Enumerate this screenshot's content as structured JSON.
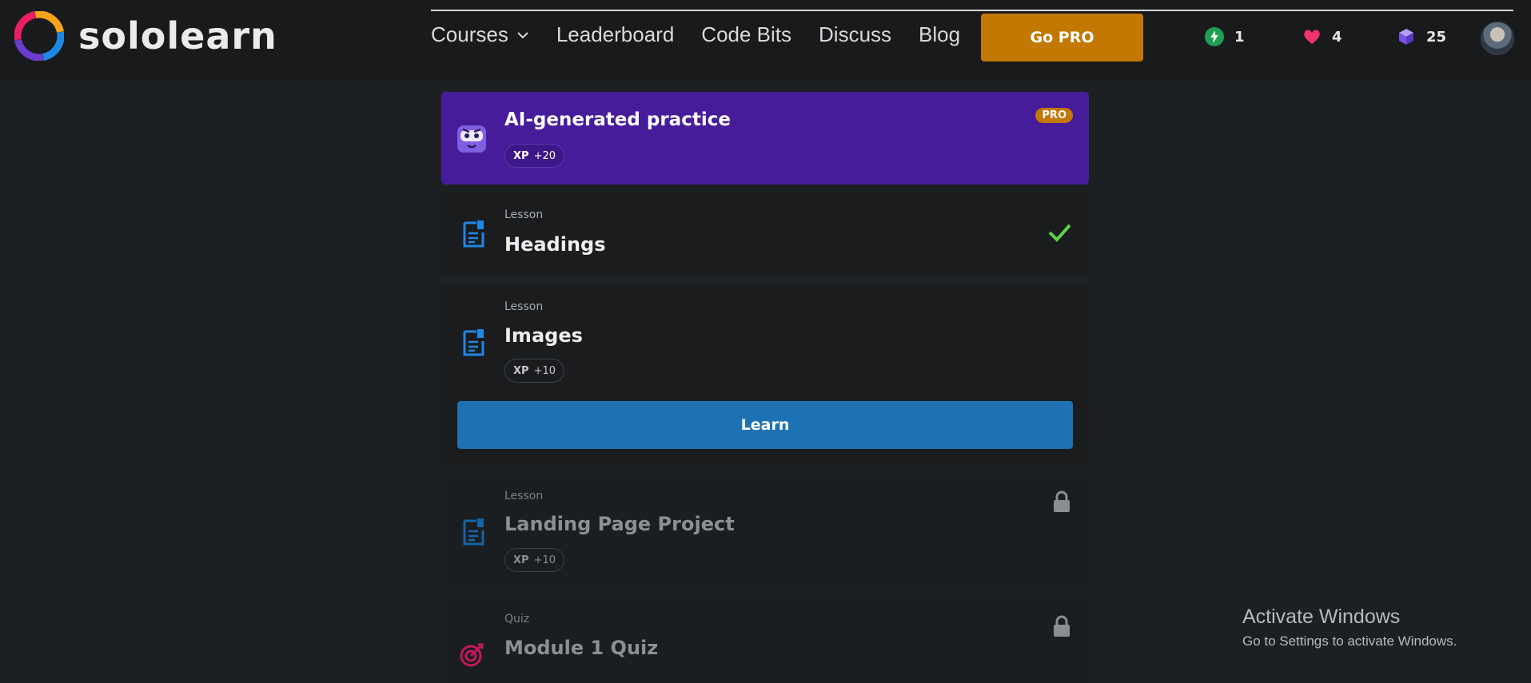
{
  "brand": {
    "name": "sololearn"
  },
  "nav": {
    "courses": "Courses",
    "leaderboard": "Leaderboard",
    "code_bits": "Code Bits",
    "discuss": "Discuss",
    "blog": "Blog",
    "go_pro": "Go PRO"
  },
  "stats": {
    "streak": "1",
    "hearts": "4",
    "gems": "25"
  },
  "ai_practice": {
    "title": "AI-generated practice",
    "badge": "PRO",
    "xp_label": "XP",
    "xp_value": "+20"
  },
  "lessons": [
    {
      "kind": "Lesson",
      "title": "Headings",
      "status": "completed"
    },
    {
      "kind": "Lesson",
      "title": "Images",
      "xp_label": "XP",
      "xp_value": "+10",
      "button": "Learn",
      "status": "current"
    },
    {
      "kind": "Lesson",
      "title": "Landing Page Project",
      "xp_label": "XP",
      "xp_value": "+10",
      "status": "locked"
    },
    {
      "kind": "Quiz",
      "title": "Module 1 Quiz",
      "status": "locked"
    }
  ],
  "watermark": {
    "title": "Activate Windows",
    "subtitle": "Go to Settings to activate Windows."
  },
  "colors": {
    "accent_pro": "#c27803",
    "learn_blue": "#1e72b4",
    "ai_purple": "#471c9b",
    "check_green": "#5ed049"
  }
}
